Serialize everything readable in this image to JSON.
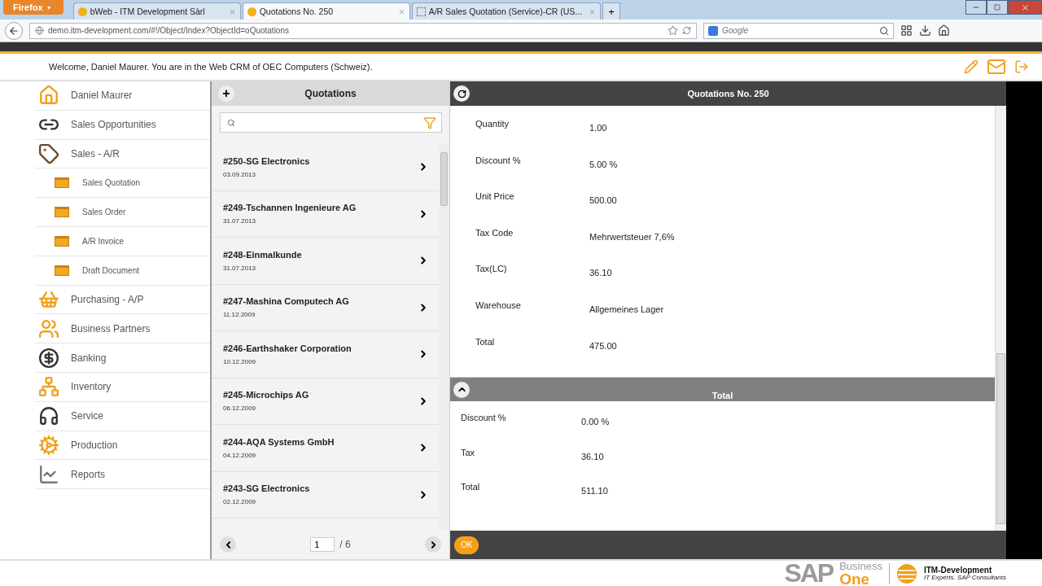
{
  "browser": {
    "menu_button": "Firefox",
    "menu_caret": "▼",
    "tabs": [
      {
        "title": "bWeb - ITM Development Sàrl",
        "selected": false
      },
      {
        "title": "Quotations No. 250",
        "selected": true
      },
      {
        "title": "A/R Sales Quotation (Service)-CR (US...",
        "selected": false
      }
    ],
    "new_tab": "+",
    "address": "demo.itm-development.com/#!/Object/Index?ObjectId=oQuotations",
    "search_placeholder": "Google"
  },
  "header": {
    "welcome": "Welcome, Daniel Maurer. You are in the Web CRM of OEC Computers (Schweiz)."
  },
  "sidebar": {
    "items": [
      {
        "label": "Daniel Maurer"
      },
      {
        "label": "Sales Opportunities"
      },
      {
        "label": "Sales - A/R",
        "children": [
          {
            "label": "Sales Quotation"
          },
          {
            "label": "Sales Order"
          },
          {
            "label": "A/R Invoice"
          },
          {
            "label": "Draft Document"
          }
        ]
      },
      {
        "label": "Purchasing - A/P"
      },
      {
        "label": "Business Partners"
      },
      {
        "label": "Banking"
      },
      {
        "label": "Inventory"
      },
      {
        "label": "Service"
      },
      {
        "label": "Production"
      },
      {
        "label": "Reports"
      }
    ]
  },
  "list": {
    "title": "Quotations",
    "add": "+",
    "rows": [
      {
        "title": "#250-SG Electronics",
        "date": "03.09.2013"
      },
      {
        "title": "#249-Tschannen Ingenieure AG",
        "date": "31.07.2013"
      },
      {
        "title": "#248-Einmalkunde",
        "date": "31.07.2013"
      },
      {
        "title": "#247-Mashina Computech AG",
        "date": "11.12.2009"
      },
      {
        "title": "#246-Earthshaker Corporation",
        "date": "10.12.2009"
      },
      {
        "title": "#245-Microchips AG",
        "date": "06.12.2009"
      },
      {
        "title": "#244-AQA Systems GmbH",
        "date": "04.12.2009"
      },
      {
        "title": "#243-SG Electronics",
        "date": "02.12.2009"
      }
    ],
    "page": "1",
    "pages": "/ 6"
  },
  "detail": {
    "title": "Quotations No. 250",
    "fields": [
      {
        "label": "Quantity",
        "value": "1.00"
      },
      {
        "label": "Discount %",
        "value": "5.00 %"
      },
      {
        "label": "Unit Price",
        "value": "500.00"
      },
      {
        "label": "Tax Code",
        "value": "Mehrwertsteuer 7,6%"
      },
      {
        "label": "Tax(LC)",
        "value": "36.10"
      },
      {
        "label": "Warehouse",
        "value": "Allgemeines Lager"
      },
      {
        "label": "Total",
        "value": "475.00"
      }
    ],
    "total_section": {
      "title": "Total",
      "expanded": true,
      "fields": [
        {
          "label": "Discount %",
          "value": "0.00 %"
        },
        {
          "label": "Tax",
          "value": "36.10"
        },
        {
          "label": "Total",
          "value": "511.10"
        }
      ]
    },
    "ok": "OK"
  },
  "footer": {
    "sap": "SAP",
    "business": "Business",
    "one": "One",
    "itm": "ITM-Development",
    "itm_tagline": "IT Experts. SAP Consultants"
  }
}
